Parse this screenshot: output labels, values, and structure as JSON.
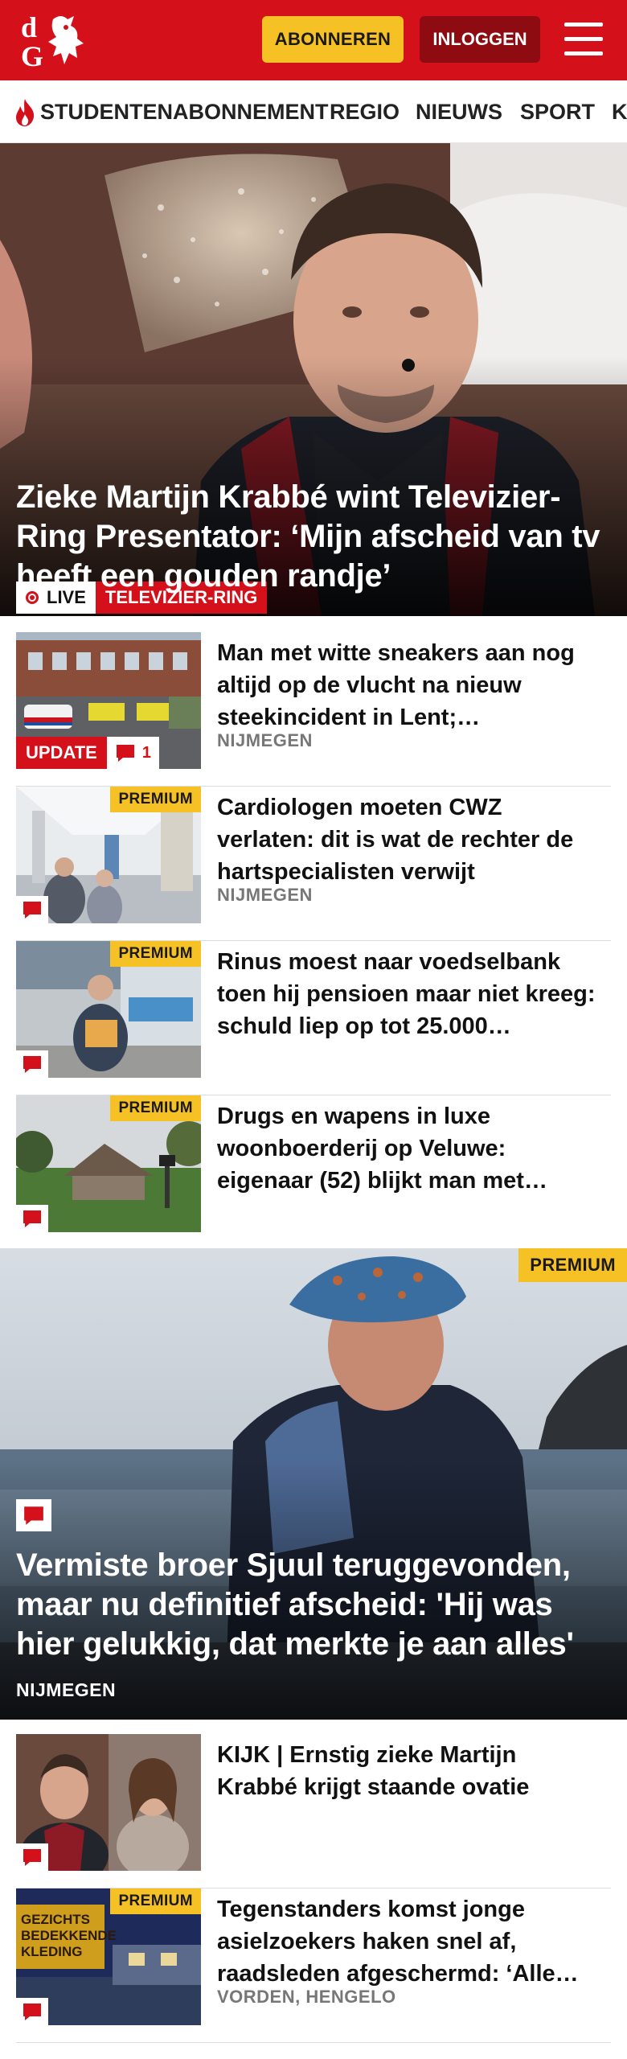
{
  "header": {
    "logo_text": "dG",
    "subscribe_label": "ABONNEREN",
    "login_label": "INLOGGEN",
    "brand_color": "#d4101b",
    "accent_color": "#f6c125"
  },
  "nav": {
    "items": [
      "STUDENTENABONNEMENT",
      "REGIO",
      "NIEUWS",
      "SPORT",
      "K"
    ],
    "featured_icon": "flame-icon"
  },
  "hero": {
    "live_label": "LIVE",
    "tag": "TELEVIZIER-RING",
    "title": "Zieke Martijn Krabbé wint Televizier-Ring Presentator: ‘Mijn afscheid van tv heeft een gouden randje’"
  },
  "articles": [
    {
      "title": "Man met witte sneakers aan nog altijd op de vlucht na nieuw steekincident in Lent;…",
      "region": "NIJMEGEN",
      "update_label": "UPDATE",
      "comment_count": "1"
    },
    {
      "title": "Cardiologen moeten CWZ verlaten: dit is wat de rechter de hartspecialisten verwijt",
      "region": "NIJMEGEN",
      "premium_label": "PREMIUM"
    },
    {
      "title": "Rinus moest naar voedselbank toen hij pensioen maar niet kreeg: schuld liep op tot 25.000…",
      "premium_label": "PREMIUM"
    },
    {
      "title": "Drugs en wapens in luxe woonboerderij op Veluwe: eigenaar (52) blijkt man met…",
      "premium_label": "PREMIUM"
    }
  ],
  "big_story": {
    "premium_label": "PREMIUM",
    "title": "Vermiste broer Sjuul teruggevonden, maar nu definitief afscheid: 'Hij was hier gelukkig, dat merkte je aan alles'",
    "region": "NIJMEGEN"
  },
  "articles_bottom": [
    {
      "title": "KIJK | Ernstig zieke Martijn Krabbé krijgt staande ovatie"
    },
    {
      "title": "Tegenstanders komst jonge asielzoekers haken snel af, raadsleden afgeschermd: ‘Alle…",
      "region": "VORDEN, HENGELO",
      "premium_label": "PREMIUM",
      "sign_text": "GEZICHTS BEDEKKENDE KLEDING"
    }
  ]
}
